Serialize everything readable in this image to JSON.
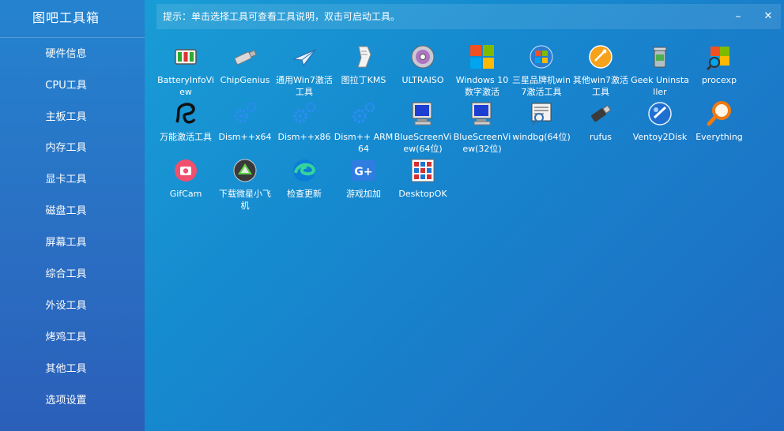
{
  "sidebar": {
    "title": "图吧工具箱",
    "items": [
      "硬件信息",
      "CPU工具",
      "主板工具",
      "内存工具",
      "显卡工具",
      "磁盘工具",
      "屏幕工具",
      "综合工具",
      "外设工具",
      "烤鸡工具",
      "其他工具",
      "选项设置"
    ]
  },
  "hint": {
    "text": "提示：单击选择工具可查看工具说明，双击可启动工具。",
    "minimize_symbol": "–",
    "close_symbol": "✕"
  },
  "tools": [
    {
      "label": "BatteryInfoView",
      "icon": "battery-icon"
    },
    {
      "label": "ChipGenius",
      "icon": "usb-drive-icon"
    },
    {
      "label": "通用Win7激活工具",
      "icon": "paper-plane-icon"
    },
    {
      "label": "图拉丁KMS",
      "icon": "scroll-icon"
    },
    {
      "label": "ULTRAISO",
      "icon": "disc-icon"
    },
    {
      "label": "Windows 10数字激活",
      "icon": "windows-logo-icon"
    },
    {
      "label": "三星品牌机win7激活工具",
      "icon": "windows7-orb-icon"
    },
    {
      "label": "其他win7激活工具",
      "icon": "orange-circle-icon"
    },
    {
      "label": "Geek Uninstaller",
      "icon": "trash-can-icon"
    },
    {
      "label": "procexp",
      "icon": "process-explorer-icon"
    },
    {
      "label": "万能激活工具",
      "icon": "dragon-icon"
    },
    {
      "label": "Dism++x64",
      "icon": "gears-icon"
    },
    {
      "label": "Dism++x86",
      "icon": "gears-icon"
    },
    {
      "label": "Dism++ ARM64",
      "icon": "gears-icon"
    },
    {
      "label": "BlueScreenView(64位)",
      "icon": "monitor-icon"
    },
    {
      "label": "BlueScreenView(32位)",
      "icon": "monitor-icon"
    },
    {
      "label": "windbg(64位)",
      "icon": "debugger-icon"
    },
    {
      "label": "rufus",
      "icon": "usb-stick-icon"
    },
    {
      "label": "Ventoy2Disk",
      "icon": "ventoy-icon"
    },
    {
      "label": "Everything",
      "icon": "magnifier-icon"
    },
    {
      "label": "GifCam",
      "icon": "camera-icon"
    },
    {
      "label": "下载微星小飞机",
      "icon": "afterburner-icon"
    },
    {
      "label": "检查更新",
      "icon": "edge-icon"
    },
    {
      "label": "游戏加加",
      "icon": "gplus-icon"
    },
    {
      "label": "DesktopOK",
      "icon": "grid-icon"
    }
  ]
}
